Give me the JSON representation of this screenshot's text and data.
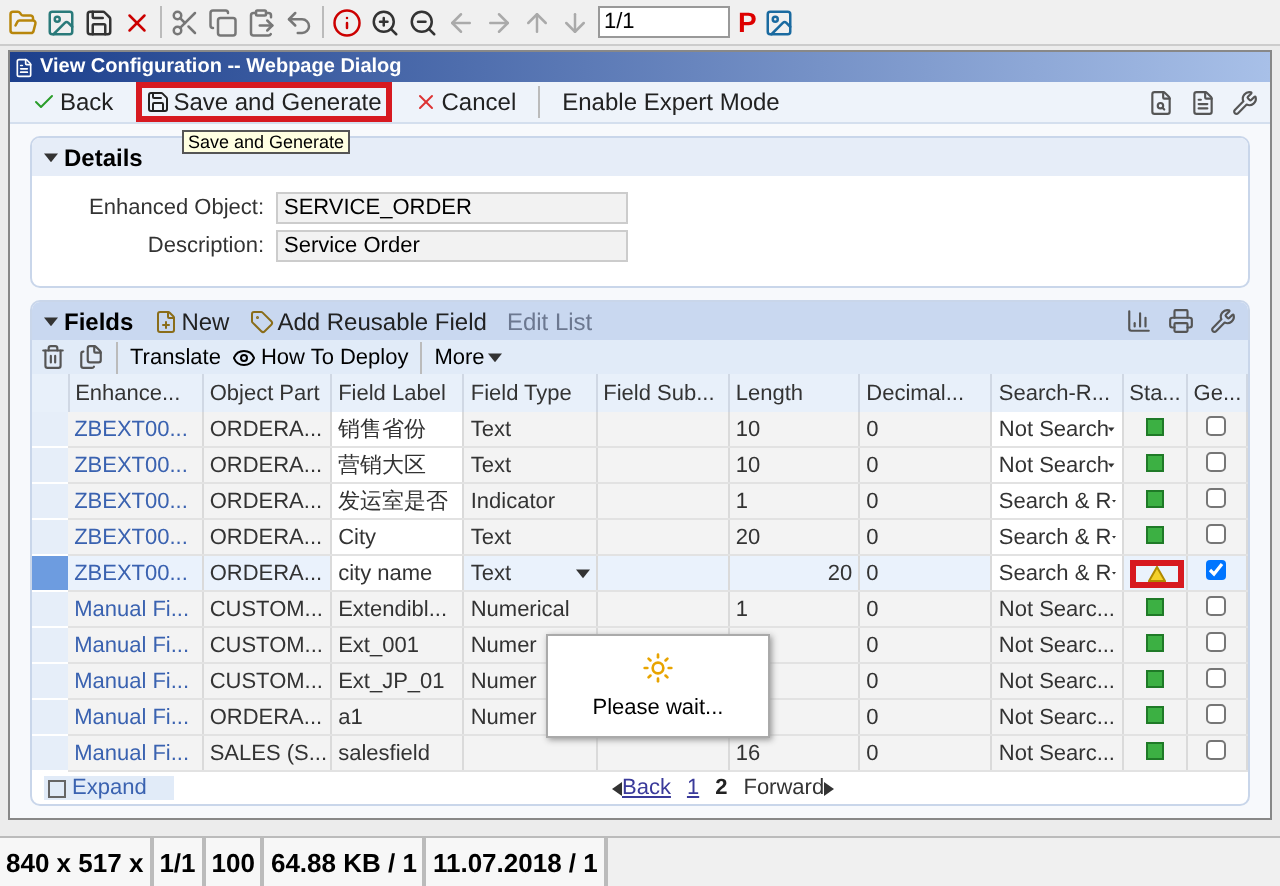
{
  "viewer_toolbar": {
    "page": "1/1",
    "p_label": "P"
  },
  "dialog": {
    "title": "View Configuration -- Webpage Dialog"
  },
  "toolbar": [
    {
      "label": "Back",
      "kind": "back",
      "highlighted": false
    },
    {
      "label": "Save and Generate",
      "kind": "save",
      "highlighted": true
    },
    {
      "label": "Cancel",
      "kind": "cancel",
      "highlighted": false
    },
    {
      "label": "Enable Expert Mode",
      "kind": "plain",
      "highlighted": false
    }
  ],
  "tooltip": "Save and Generate",
  "details": {
    "title": "Details",
    "expanded": true,
    "fields": [
      {
        "label": "Enhanced Object:",
        "value": "SERVICE_ORDER"
      },
      {
        "label": "Description:",
        "value": "Service Order"
      }
    ]
  },
  "fields": {
    "title": "Fields",
    "expanded": true,
    "actions": [
      {
        "label": "New",
        "kind": "new",
        "disabled": false
      },
      {
        "label": "Add Reusable Field",
        "kind": "reusable",
        "disabled": false
      },
      {
        "label": "Edit List",
        "kind": "plain",
        "disabled": true
      }
    ],
    "subactions": [
      {
        "label": "Translate",
        "kind": "plain"
      },
      {
        "label": "How To Deploy",
        "kind": "deploy"
      },
      {
        "label": "More",
        "kind": "menu"
      }
    ],
    "columns": [
      "Enhance...",
      "Object Part",
      "Field Label",
      "Field Type",
      "Field Sub...",
      "Length",
      "Decimal...",
      "Search-R...",
      "Sta...",
      "Ge..."
    ],
    "rows": [
      {
        "enhancement": "ZBEXT00...",
        "object_part": "ORDERA...",
        "label": "销售省份",
        "type": "Text",
        "length": "10",
        "decimal": "0",
        "search": "Not Search",
        "kind": "ok",
        "status_highlighted": false,
        "checked": false,
        "editable": true,
        "selected": false
      },
      {
        "enhancement": "ZBEXT00...",
        "object_part": "ORDERA...",
        "label": "营销大区",
        "type": "Text",
        "length": "10",
        "decimal": "0",
        "search": "Not Search",
        "kind": "ok",
        "status_highlighted": false,
        "checked": false,
        "editable": true,
        "selected": false
      },
      {
        "enhancement": "ZBEXT00...",
        "object_part": "ORDERA...",
        "label": "发运室是否",
        "type": "Indicator",
        "length": "1",
        "decimal": "0",
        "search": "Search & R",
        "kind": "ok",
        "status_highlighted": false,
        "checked": false,
        "editable": true,
        "selected": false
      },
      {
        "enhancement": "ZBEXT00...",
        "object_part": "ORDERA...",
        "label": "City",
        "type": "Text",
        "length": "20",
        "decimal": "0",
        "search": "Search & R",
        "kind": "ok",
        "status_highlighted": false,
        "checked": false,
        "editable": true,
        "selected": false
      },
      {
        "enhancement": "ZBEXT00...",
        "object_part": "ORDERA...",
        "label": "city name",
        "type": "Text",
        "length": "20",
        "decimal": "0",
        "search": "Search & R",
        "kind": "warning",
        "status_highlighted": true,
        "checked": true,
        "editable": true,
        "selected": true
      },
      {
        "enhancement": "Manual Fi...",
        "object_part": "CUSTOM...",
        "label": "Extendibl...",
        "type": "Numerical",
        "length": "1",
        "decimal": "0",
        "search": "Not Searc...",
        "kind": "ok",
        "status_highlighted": false,
        "checked": false,
        "editable": false,
        "selected": false
      },
      {
        "enhancement": "Manual Fi...",
        "object_part": "CUSTOM...",
        "label": "Ext_001",
        "type": "Numer",
        "decimal": "0",
        "search": "Not Searc...",
        "kind": "ok",
        "status_highlighted": false,
        "checked": false,
        "editable": false,
        "selected": false
      },
      {
        "enhancement": "Manual Fi...",
        "object_part": "CUSTOM...",
        "label": "Ext_JP_01",
        "type": "Numer",
        "decimal": "0",
        "search": "Not Searc...",
        "kind": "ok",
        "status_highlighted": false,
        "checked": false,
        "editable": false,
        "selected": false
      },
      {
        "enhancement": "Manual Fi...",
        "object_part": "ORDERA...",
        "label": "a1",
        "type": "Numer",
        "decimal": "0",
        "search": "Not Searc...",
        "kind": "ok",
        "status_highlighted": false,
        "checked": false,
        "editable": false,
        "selected": false
      },
      {
        "enhancement": "Manual Fi...",
        "object_part": "SALES (S...",
        "label": "salesfield",
        "length": "16",
        "decimal": "0",
        "search": "Not Searc...",
        "kind": "ok",
        "status_highlighted": false,
        "checked": false,
        "editable": false,
        "selected": false
      }
    ],
    "expand": "Expand",
    "pager": {
      "back": "Back",
      "pages": [
        {
          "label": "1",
          "selected": false
        },
        {
          "label": "2",
          "selected": true
        }
      ],
      "forward": "Forward"
    }
  },
  "loading": {
    "text": "Please wait..."
  },
  "status_bar": [
    "840 x 517 x",
    "1/1",
    "100",
    "64.88 KB / 1",
    "11.07.2018 / 1"
  ]
}
